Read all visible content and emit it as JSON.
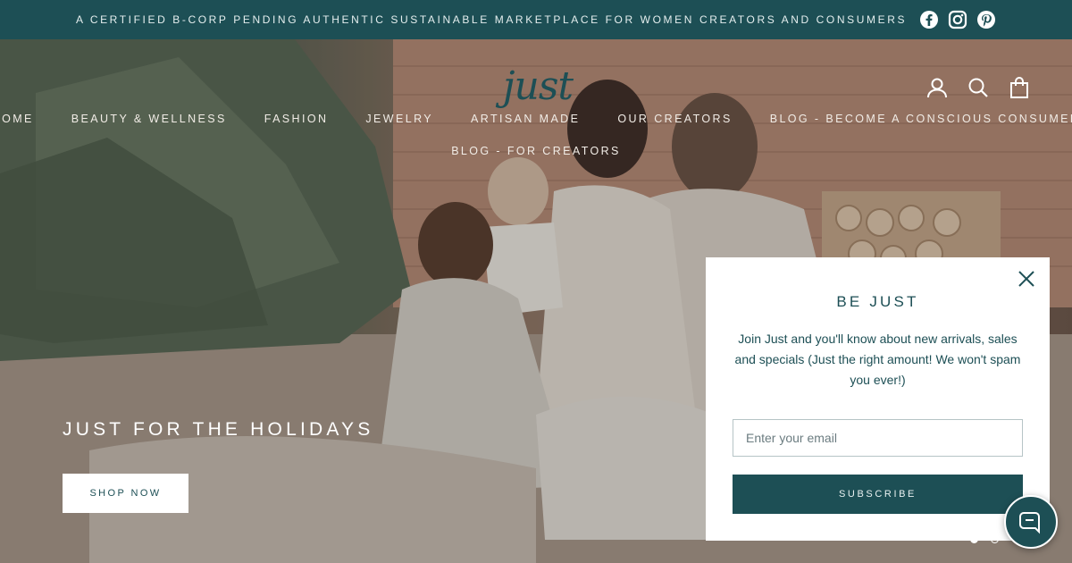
{
  "announcement": {
    "text": "A CERTIFIED B-CORP PENDING AUTHENTIC SUSTAINABLE MARKETPLACE FOR WOMEN CREATORS AND CONSUMERS",
    "social_icons": [
      "facebook-icon",
      "instagram-icon",
      "pinterest-icon"
    ]
  },
  "header": {
    "logo_text": "just",
    "icons": [
      "account-icon",
      "search-icon",
      "cart-icon"
    ]
  },
  "nav": {
    "row1": [
      "HOME",
      "BEAUTY & WELLNESS",
      "FASHION",
      "JEWELRY",
      "ARTISAN MADE",
      "OUR CREATORS",
      "BLOG - BECOME A CONSCIOUS CONSUMER"
    ],
    "row2": [
      "BLOG - FOR CREATORS"
    ]
  },
  "hero": {
    "title": "JUST FOR THE HOLIDAYS",
    "button": "SHOP NOW",
    "slides": 2,
    "active_slide": 1
  },
  "popup": {
    "title": "BE JUST",
    "text": "Join Just and you'll know about new arrivals, sales and specials (Just the right amount! We won't spam you ever!)",
    "email_placeholder": "Enter your email",
    "email_value": "",
    "button": "SUBSCRIBE"
  },
  "colors": {
    "brand": "#1d4f55",
    "popup_bg": "#ffffff",
    "nav_text": "#f1ece6"
  }
}
